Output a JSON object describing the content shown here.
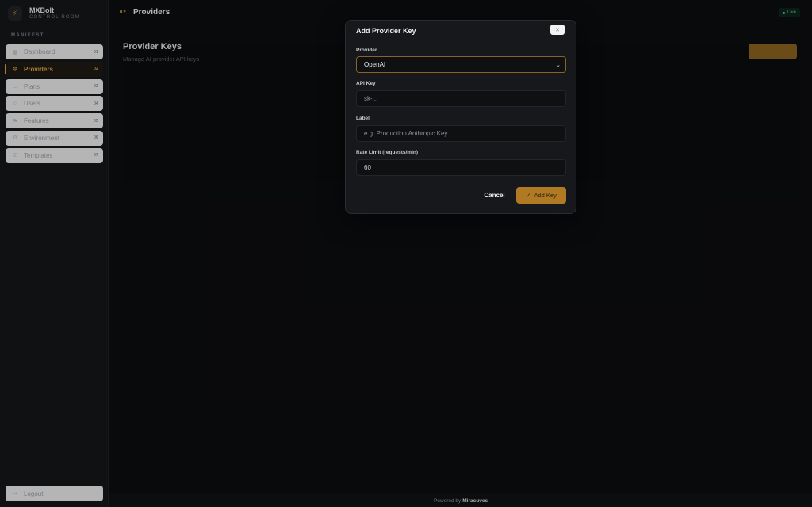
{
  "brand": {
    "name": "MXBolt",
    "subtitle": "CONTROL ROOM",
    "logo_icon": "bolt-icon"
  },
  "sidebar": {
    "section_label": "MANIFEST",
    "items": [
      {
        "label": "Dashboard",
        "num": "01",
        "icon": "grid-icon",
        "active": false
      },
      {
        "label": "Providers",
        "num": "02",
        "icon": "plug-icon",
        "active": true
      },
      {
        "label": "Plans",
        "num": "03",
        "icon": "folder-icon",
        "active": false
      },
      {
        "label": "Users",
        "num": "04",
        "icon": "users-icon",
        "active": false
      },
      {
        "label": "Features",
        "num": "05",
        "icon": "flag-icon",
        "active": false
      },
      {
        "label": "Environment",
        "num": "06",
        "icon": "gear-icon",
        "active": false
      },
      {
        "label": "Templates",
        "num": "07",
        "icon": "template-icon",
        "active": false
      }
    ],
    "logout_label": "Logout"
  },
  "topbar": {
    "crumb_num": "02",
    "title": "Providers",
    "status": "Live"
  },
  "main": {
    "title": "Provider Keys",
    "subtitle": "Manage AI provider API keys"
  },
  "modal": {
    "title": "Add Provider Key",
    "fields": {
      "provider_label": "Provider",
      "provider_value": "OpenAI",
      "api_key_label": "API Key",
      "api_key_placeholder": "sk-...",
      "label_label": "Label",
      "label_placeholder": "e.g. Production Anthropic Key",
      "rate_label": "Rate Limit (requests/min)",
      "rate_value": "60"
    },
    "cancel_label": "Cancel",
    "add_label": "Add Key"
  },
  "footer": {
    "prefix": "Powered by",
    "brand": "Miracuves"
  },
  "colors": {
    "accent": "#e6a542",
    "live": "#4ad19a",
    "bg": "#0d0e10"
  }
}
